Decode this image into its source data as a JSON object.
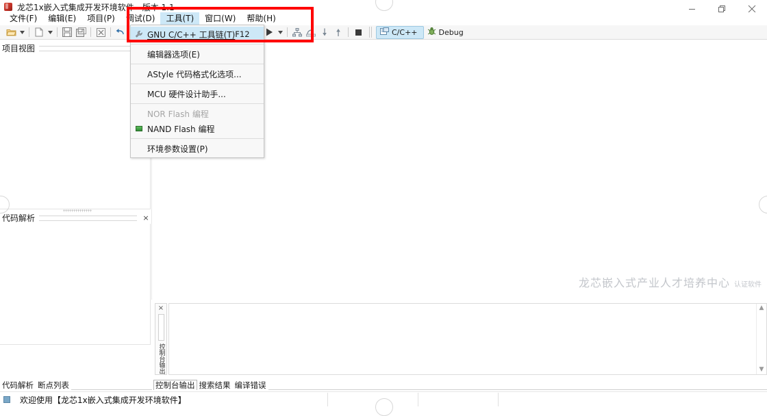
{
  "window": {
    "title": "龙芯1x嵌入式集成开发环境软件 - 版本 1.1",
    "icon": "app-icon",
    "controls": {
      "minimize": "minimize-icon",
      "maximize": "restore-icon",
      "close": "close-icon"
    }
  },
  "menubar": {
    "items": [
      {
        "label": "文件(F)",
        "active": false
      },
      {
        "label": "编辑(E)",
        "active": false
      },
      {
        "label": "项目(P)",
        "active": false
      },
      {
        "label": "调试(D)",
        "active": false
      },
      {
        "label": "工具(T)",
        "active": true
      },
      {
        "label": "窗口(W)",
        "active": false
      },
      {
        "label": "帮助(H)",
        "active": false
      }
    ]
  },
  "toolbar": {
    "buttons": [
      {
        "name": "open-folder-icon",
        "caret": true
      },
      {
        "name": "new-file-icon",
        "caret": true
      },
      {
        "name": "save-icon",
        "caret": false
      },
      {
        "name": "save-all-icon",
        "caret": false
      },
      {
        "name": "build-clean-icon",
        "caret": false
      },
      {
        "name": "undo-icon",
        "caret": false
      },
      {
        "name": "redo-icon",
        "caret": false
      },
      {
        "name": "run-icon",
        "caret": true
      },
      {
        "name": "debug-hierarchy-icon",
        "caret": false
      },
      {
        "name": "step-over-icon",
        "caret": false
      },
      {
        "name": "step-into-icon",
        "caret": false
      },
      {
        "name": "step-return-icon",
        "caret": false
      },
      {
        "name": "stop-icon",
        "caret": false
      }
    ],
    "perspectives": [
      {
        "label": "C/C++",
        "icon": "cpp-perspective-icon",
        "selected": true
      },
      {
        "label": "Debug",
        "icon": "debug-perspective-icon",
        "selected": false
      }
    ]
  },
  "dropdown": {
    "open_for": "工具(T)",
    "items": [
      {
        "label": "GNU C/C++ 工具链(T)",
        "shortcut": "F12",
        "highlighted": true,
        "disabled": false,
        "icon": "wrench-icon",
        "separator_after": true
      },
      {
        "label": "编辑器选项(E)",
        "shortcut": "",
        "highlighted": false,
        "disabled": false,
        "icon": "",
        "separator_after": true
      },
      {
        "label": "AStyle 代码格式化选项...",
        "shortcut": "",
        "highlighted": false,
        "disabled": false,
        "icon": "",
        "separator_after": true
      },
      {
        "label": "MCU 硬件设计助手...",
        "shortcut": "",
        "highlighted": false,
        "disabled": false,
        "icon": "",
        "separator_after": true
      },
      {
        "label": "NOR Flash 编程",
        "shortcut": "",
        "highlighted": false,
        "disabled": true,
        "icon": "",
        "separator_after": false
      },
      {
        "label": "NAND Flash 编程",
        "shortcut": "",
        "highlighted": false,
        "disabled": false,
        "icon": "nand-flash-icon",
        "separator_after": true
      },
      {
        "label": "环境参数设置(P)",
        "shortcut": "",
        "highlighted": false,
        "disabled": false,
        "icon": "",
        "separator_after": false
      }
    ]
  },
  "panels": {
    "project_view": {
      "title": "项目视图",
      "close": "×"
    },
    "code_parse": {
      "title": "代码解析",
      "close": "×"
    }
  },
  "editor": {
    "watermark_main": "龙芯嵌入式产业人才培养中心",
    "watermark_sub": "认证软件"
  },
  "console": {
    "minimized_label": "控制台输出",
    "close": "×"
  },
  "tabs_left": [
    {
      "label": "代码解析",
      "selected": false
    },
    {
      "label": "断点列表",
      "selected": false
    }
  ],
  "tabs_right": [
    {
      "label": "控制台输出",
      "selected": true
    },
    {
      "label": "搜索结果",
      "selected": false
    },
    {
      "label": "编译错误",
      "selected": false
    }
  ],
  "statusbar": {
    "icon": "console-status-icon",
    "message": "欢迎使用【龙芯1x嵌入式集成开发环境软件】"
  },
  "annotation": {
    "color": "#ff0000",
    "shape": "rectangle"
  }
}
